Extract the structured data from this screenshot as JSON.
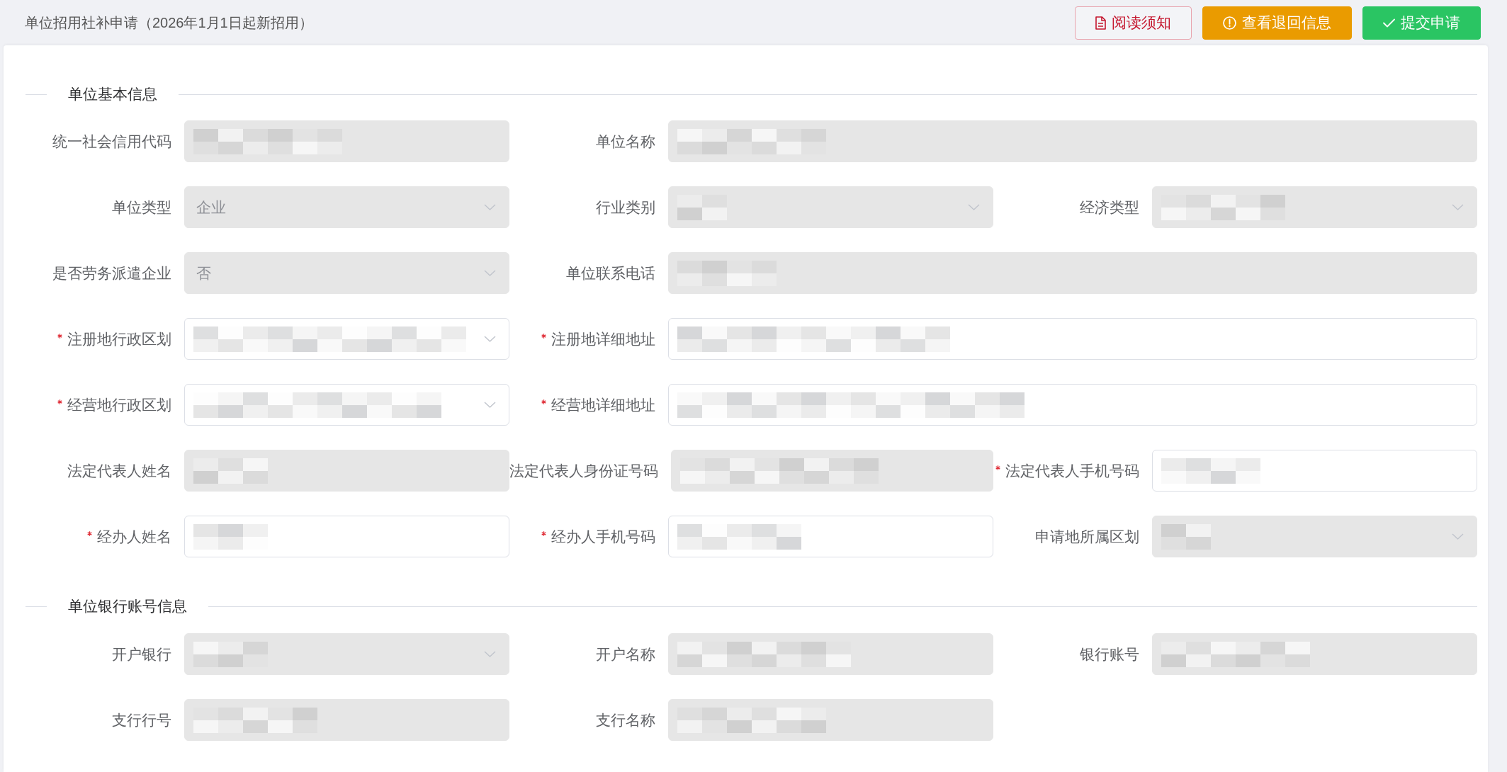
{
  "header": {
    "title": "单位招用社补申请（2026年1月1日起新招用）",
    "buttons": [
      {
        "kind": "danger",
        "label": "阅读须知"
      },
      {
        "kind": "warning",
        "label": "查看退回信息"
      },
      {
        "kind": "success",
        "label": "提交申请"
      }
    ]
  },
  "sections": [
    {
      "title": "单位基本信息",
      "rows": [
        {
          "fields": [
            {
              "label": "统一社会信用代码",
              "kind": "input",
              "required": false,
              "disabled": true,
              "wide": false,
              "redacted": true
            },
            {
              "label": "单位名称",
              "kind": "input",
              "required": false,
              "disabled": true,
              "wide": true,
              "redacted": true
            }
          ]
        },
        {
          "fields": [
            {
              "label": "单位类型",
              "kind": "select",
              "required": false,
              "disabled": true,
              "wide": false,
              "redacted": false,
              "value": "企业"
            },
            {
              "label": "行业类别",
              "kind": "select",
              "required": false,
              "disabled": true,
              "wide": false,
              "redacted": true
            },
            {
              "label": "经济类型",
              "kind": "select",
              "required": false,
              "disabled": true,
              "wide": false,
              "redacted": true
            }
          ]
        },
        {
          "fields": [
            {
              "label": "是否劳务派遣企业",
              "kind": "select",
              "required": false,
              "disabled": true,
              "wide": false,
              "redacted": false,
              "value": "否"
            },
            {
              "label": "单位联系电话",
              "kind": "input",
              "required": false,
              "disabled": true,
              "wide": true,
              "redacted": true
            }
          ]
        },
        {
          "fields": [
            {
              "label": "注册地行政区划",
              "kind": "select",
              "required": true,
              "disabled": false,
              "wide": false,
              "redacted": true
            },
            {
              "label": "注册地详细地址",
              "kind": "input",
              "required": true,
              "disabled": false,
              "wide": true,
              "redacted": true
            }
          ]
        },
        {
          "fields": [
            {
              "label": "经营地行政区划",
              "kind": "select",
              "required": true,
              "disabled": false,
              "wide": false,
              "redacted": true
            },
            {
              "label": "经营地详细地址",
              "kind": "input",
              "required": true,
              "disabled": false,
              "wide": true,
              "redacted": true
            }
          ]
        },
        {
          "fields": [
            {
              "label": "法定代表人姓名",
              "kind": "input",
              "required": false,
              "disabled": true,
              "wide": false,
              "redacted": true
            },
            {
              "label": "法定代表人身份证号码",
              "kind": "input",
              "required": false,
              "disabled": true,
              "wide": false,
              "redacted": true
            },
            {
              "label": "法定代表人手机号码",
              "kind": "input",
              "required": true,
              "disabled": false,
              "wide": false,
              "redacted": true
            }
          ]
        },
        {
          "fields": [
            {
              "label": "经办人姓名",
              "kind": "input",
              "required": true,
              "disabled": false,
              "wide": false,
              "redacted": true
            },
            {
              "label": "经办人手机号码",
              "kind": "input",
              "required": true,
              "disabled": false,
              "wide": false,
              "redacted": true
            },
            {
              "label": "申请地所属区划",
              "kind": "select",
              "required": false,
              "disabled": true,
              "wide": false,
              "redacted": true
            }
          ]
        }
      ]
    },
    {
      "title": "单位银行账号信息",
      "rows": [
        {
          "fields": [
            {
              "label": "开户银行",
              "kind": "select",
              "required": false,
              "disabled": true,
              "wide": false,
              "redacted": true
            },
            {
              "label": "开户名称",
              "kind": "input",
              "required": false,
              "disabled": true,
              "wide": false,
              "redacted": true
            },
            {
              "label": "银行账号",
              "kind": "input",
              "required": false,
              "disabled": true,
              "wide": false,
              "redacted": true
            }
          ]
        },
        {
          "fields": [
            {
              "label": "支行行号",
              "kind": "input",
              "required": false,
              "disabled": true,
              "wide": false,
              "redacted": true
            },
            {
              "label": "支行名称",
              "kind": "input",
              "required": false,
              "disabled": true,
              "wide": false,
              "redacted": true
            }
          ]
        }
      ]
    }
  ]
}
